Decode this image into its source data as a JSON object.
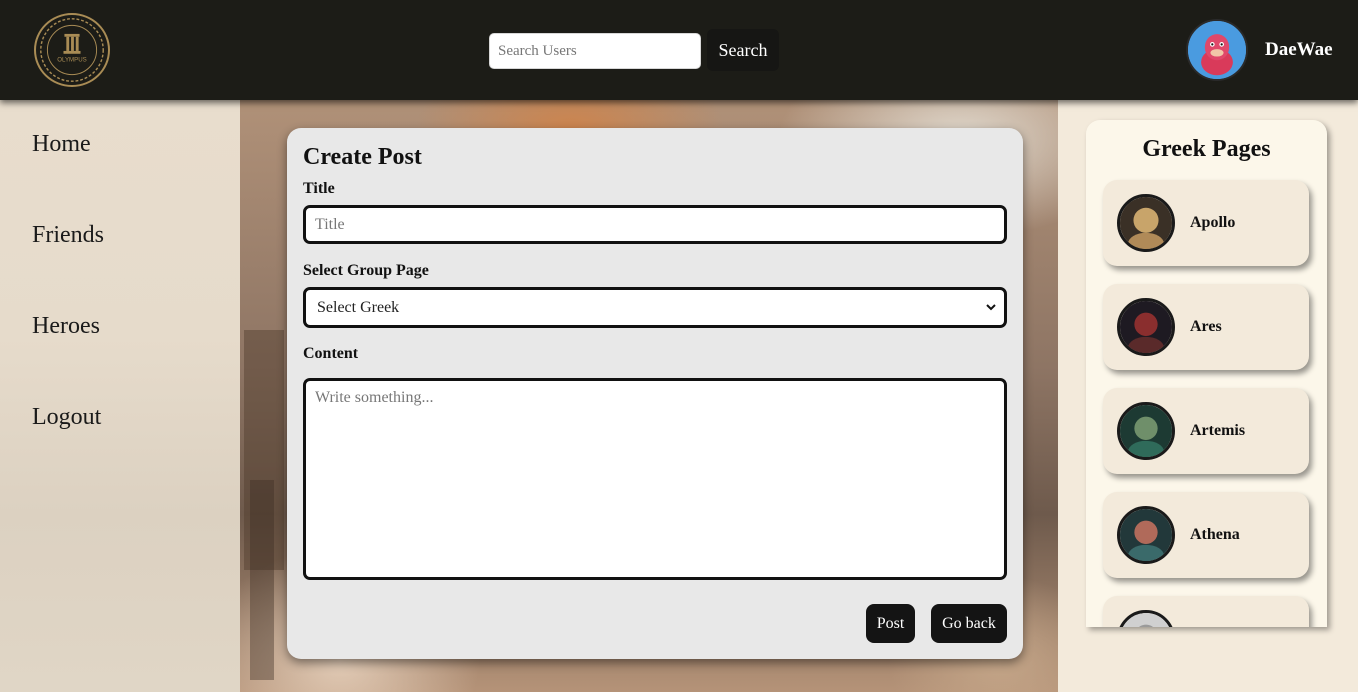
{
  "header": {
    "logo_text": "OLYMPUS",
    "search_placeholder": "Search Users",
    "search_button": "Search",
    "username": "DaeWae"
  },
  "sidebar": {
    "items": [
      {
        "label": "Home"
      },
      {
        "label": "Friends"
      },
      {
        "label": "Heroes"
      },
      {
        "label": "Logout"
      }
    ]
  },
  "create_post": {
    "heading": "Create Post",
    "title_label": "Title",
    "title_placeholder": "Title",
    "group_label": "Select Group Page",
    "group_selected": "Select Greek",
    "content_label": "Content",
    "content_placeholder": "Write something...",
    "post_button": "Post",
    "back_button": "Go back"
  },
  "greek_pages": {
    "heading": "Greek Pages",
    "pages": [
      {
        "name": "Apollo",
        "color": "#c8a46a"
      },
      {
        "name": "Ares",
        "color": "#8a2e2e"
      },
      {
        "name": "Artemis",
        "color": "#2f6b5a"
      },
      {
        "name": "Athena",
        "color": "#3a6a6a"
      },
      {
        "name": "",
        "color": "#9a9a9a"
      }
    ]
  },
  "colors": {
    "header_bg": "#1c1c17",
    "card_bg": "#e8e8e8",
    "panel_bg": "#fcf7ea",
    "page_card_bg": "#f3eadb",
    "button_dark": "#141414"
  }
}
